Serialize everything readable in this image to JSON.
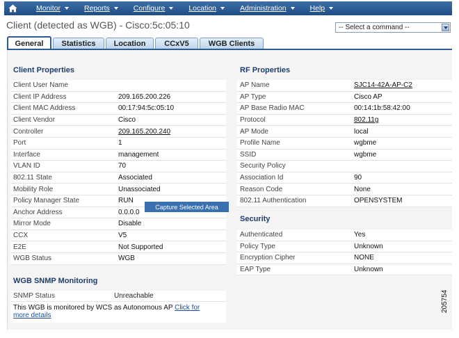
{
  "nav": {
    "items": [
      {
        "label": "Monitor"
      },
      {
        "label": "Reports"
      },
      {
        "label": "Configure"
      },
      {
        "label": "Location"
      },
      {
        "label": "Administration"
      },
      {
        "label": "Help"
      }
    ]
  },
  "page": {
    "title": "Client (detected as WGB) - Cisco:5c:05:10"
  },
  "command": {
    "selected": "-- Select a command --"
  },
  "tabs": [
    {
      "label": "General"
    },
    {
      "label": "Statistics"
    },
    {
      "label": "Location"
    },
    {
      "label": "CCxV5"
    },
    {
      "label": "WGB Clients"
    }
  ],
  "client_properties": {
    "title": "Client Properties",
    "rows": [
      {
        "k": "Client User Name",
        "v": ""
      },
      {
        "k": "Client IP Address",
        "v": "209.165.200.226"
      },
      {
        "k": "Client MAC Address",
        "v": "00:17:94:5c:05:10"
      },
      {
        "k": "Client Vendor",
        "v": "Cisco"
      },
      {
        "k": "Controller",
        "v": "209.165.200.240"
      },
      {
        "k": "Port",
        "v": "1"
      },
      {
        "k": "Interface",
        "v": "management"
      },
      {
        "k": "VLAN ID",
        "v": "70"
      },
      {
        "k": "802.11 State",
        "v": "Associated"
      },
      {
        "k": "Mobility Role",
        "v": "Unassociated"
      },
      {
        "k": "Policy Manager State",
        "v": "RUN"
      },
      {
        "k": "Anchor Address",
        "v": "0.0.0.0"
      },
      {
        "k": "Mirror Mode",
        "v": "Disable"
      },
      {
        "k": "CCX",
        "v": "V5"
      },
      {
        "k": "E2E",
        "v": "Not Supported"
      },
      {
        "k": "WGB Status",
        "v": "WGB"
      }
    ]
  },
  "context_menu": {
    "label": "Capture Selected Area"
  },
  "wgb_snmp": {
    "title": "WGB SNMP Monitoring",
    "status_label": "SNMP Status",
    "status_value": "Unreachable",
    "note": "This WGB is monitored by WCS as Autonomous AP",
    "link_text_1": "Click for",
    "link_text_2": "more details"
  },
  "rf_properties": {
    "title": "RF Properties",
    "rows": [
      {
        "k": "AP Name",
        "v": "SJC14-42A-AP-C2"
      },
      {
        "k": "AP Type",
        "v": "Cisco AP"
      },
      {
        "k": "AP Base Radio MAC",
        "v": "00:14:1b:58:42:00"
      },
      {
        "k": "Protocol",
        "v": "802.11g"
      },
      {
        "k": "AP Mode",
        "v": "local"
      },
      {
        "k": "Profile Name",
        "v": "wgbme"
      },
      {
        "k": "SSID",
        "v": "wgbme"
      },
      {
        "k": "Security Policy",
        "v": ""
      },
      {
        "k": "Association Id",
        "v": "90"
      },
      {
        "k": "Reason Code",
        "v": "None"
      },
      {
        "k": "802.11 Authentication",
        "v": "OPENSYSTEM"
      }
    ]
  },
  "security": {
    "title": "Security",
    "rows": [
      {
        "k": "Authenticated",
        "v": "Yes"
      },
      {
        "k": "Policy Type",
        "v": "Unknown"
      },
      {
        "k": "Encryption Cipher",
        "v": "NONE"
      },
      {
        "k": "EAP Type",
        "v": "Unknown"
      }
    ]
  },
  "figure_number": "205754"
}
